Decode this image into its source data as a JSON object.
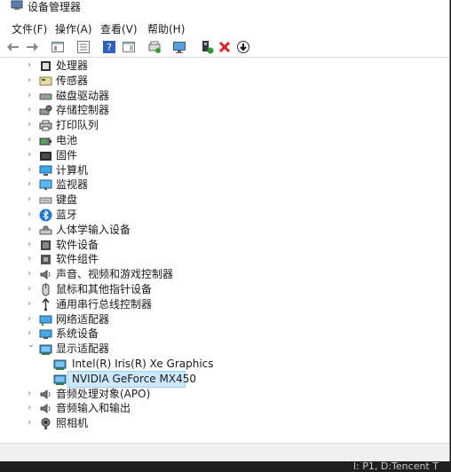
{
  "window": {
    "title": "设备管理器"
  },
  "menu": [
    {
      "label": "文件(F)"
    },
    {
      "label": "操作(A)"
    },
    {
      "label": "查看(V)"
    },
    {
      "label": "帮助(H)"
    }
  ],
  "toolbar": [
    {
      "icon": "back-arrow-icon"
    },
    {
      "icon": "forward-arrow-icon"
    },
    {
      "icon": "properties-view-icon"
    },
    {
      "icon": "console-tree-icon"
    },
    {
      "icon": "help-icon"
    },
    {
      "icon": "action-pane-icon"
    },
    {
      "icon": "update-driver-icon"
    },
    {
      "icon": "scan-hardware-icon"
    },
    {
      "icon": "enable-device-icon"
    },
    {
      "icon": "uninstall-device-icon"
    },
    {
      "icon": "download-driver-icon"
    }
  ],
  "tree": [
    {
      "label": "处理器",
      "icon": "processor-icon",
      "expanded": false
    },
    {
      "label": "传感器",
      "icon": "sensor-icon",
      "expanded": false
    },
    {
      "label": "磁盘驱动器",
      "icon": "disk-drive-icon",
      "expanded": false
    },
    {
      "label": "存储控制器",
      "icon": "storage-controller-icon",
      "expanded": false
    },
    {
      "label": "打印队列",
      "icon": "printer-icon",
      "expanded": false
    },
    {
      "label": "电池",
      "icon": "battery-icon",
      "expanded": false
    },
    {
      "label": "固件",
      "icon": "firmware-icon",
      "expanded": false
    },
    {
      "label": "计算机",
      "icon": "computer-icon",
      "expanded": false
    },
    {
      "label": "监视器",
      "icon": "monitor-icon",
      "expanded": false
    },
    {
      "label": "键盘",
      "icon": "keyboard-icon",
      "expanded": false
    },
    {
      "label": "蓝牙",
      "icon": "bluetooth-icon",
      "expanded": false
    },
    {
      "label": "人体学输入设备",
      "icon": "hid-icon",
      "expanded": false
    },
    {
      "label": "软件设备",
      "icon": "software-device-icon",
      "expanded": false
    },
    {
      "label": "软件组件",
      "icon": "software-component-icon",
      "expanded": false
    },
    {
      "label": "声音、视频和游戏控制器",
      "icon": "audio-icon",
      "expanded": false
    },
    {
      "label": "鼠标和其他指针设备",
      "icon": "mouse-icon",
      "expanded": false
    },
    {
      "label": "通用串行总线控制器",
      "icon": "usb-icon",
      "expanded": false
    },
    {
      "label": "网络适配器",
      "icon": "network-adapter-icon",
      "expanded": false
    },
    {
      "label": "系统设备",
      "icon": "system-device-icon",
      "expanded": false
    },
    {
      "label": "显示适配器",
      "icon": "display-adapter-icon",
      "expanded": true,
      "children": [
        {
          "label": "Intel(R) Iris(R) Xe Graphics",
          "icon": "display-adapter-icon",
          "selected": false
        },
        {
          "label": "NVIDIA GeForce MX450",
          "icon": "display-adapter-icon",
          "selected": true
        }
      ]
    },
    {
      "label": "音频处理对象(APO)",
      "icon": "audio-icon",
      "expanded": false
    },
    {
      "label": "音频输入和输出",
      "icon": "audio-icon",
      "expanded": false
    },
    {
      "label": "照相机",
      "icon": "camera-icon",
      "expanded": false
    }
  ],
  "background_text": {
    "taskbar_snippet": "l: P1, D:Tencent T"
  }
}
